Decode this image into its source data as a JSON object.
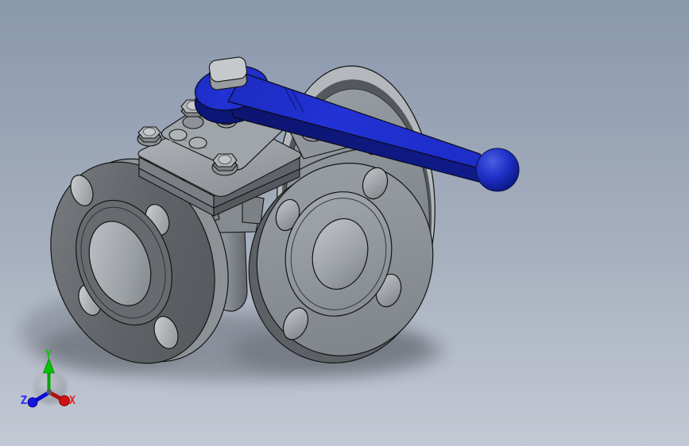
{
  "viewport": {
    "kind": "cad-3d-viewport",
    "view_orientation": "isometric",
    "background_top_color": "#8A98AC",
    "background_bottom_color": "#C3C9D3"
  },
  "model": {
    "name": "three-way-flanged-ball-valve",
    "parts": [
      {
        "id": "back-flange",
        "label": "rear port flange",
        "color": "#8E9499"
      },
      {
        "id": "left-flange",
        "label": "left port flange",
        "color": "#5E6266"
      },
      {
        "id": "front-flange",
        "label": "front port flange",
        "color": "#8F959A"
      },
      {
        "id": "valve-body",
        "label": "valve body casting",
        "color": "#8B9196"
      },
      {
        "id": "top-plate",
        "label": "bonnet mounting plate",
        "color": "#AEB3B8"
      },
      {
        "id": "lever-handle",
        "label": "lever handle",
        "color": "#2130D2"
      },
      {
        "id": "ball-knob",
        "label": "handle ball grip",
        "color": "#1B2CC0"
      },
      {
        "id": "stem-nut",
        "label": "stem nut",
        "color": "#C6C9CC"
      }
    ],
    "handle_color_top": "#2130D2",
    "handle_color_side": "#0F1982",
    "outline_color": "#141414"
  },
  "triad": {
    "axes": [
      {
        "label": "X",
        "color": "#E62222",
        "direction": "lower-right"
      },
      {
        "label": "Y",
        "color": "#10C010",
        "direction": "up"
      },
      {
        "label": "Z",
        "color": "#2A2AFF",
        "direction": "lower-left"
      }
    ]
  }
}
